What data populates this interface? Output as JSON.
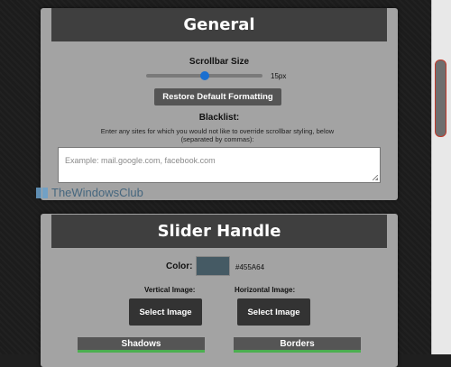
{
  "general": {
    "title": "General",
    "scrollbar_size_label": "Scrollbar Size",
    "scrollbar_size_value": "15px",
    "scrollbar_size_level": 0.5,
    "restore_button": "Restore Default Formatting",
    "blacklist_label": "Blacklist:",
    "blacklist_desc_line1": "Enter any sites for which you would not like to override scrollbar styling, below",
    "blacklist_desc_line2": "(separated by commas):",
    "blacklist_placeholder": "Example: mail.google.com, facebook.com"
  },
  "watermark": {
    "text": "TheWindowsClub"
  },
  "slider_handle": {
    "title": "Slider Handle",
    "color_label": "Color:",
    "color_value": "#455A64",
    "vertical_image_label": "Vertical Image:",
    "horizontal_image_label": "Horizontal Image:",
    "select_image_vertical": "Select Image",
    "select_image_horizontal": "Select Image",
    "shadows_label": "Shadows",
    "borders_label": "Borders"
  },
  "colors": {
    "accent_green": "#4caf50",
    "swatch": "#455A64",
    "slider_thumb": "#1a6fd0"
  }
}
